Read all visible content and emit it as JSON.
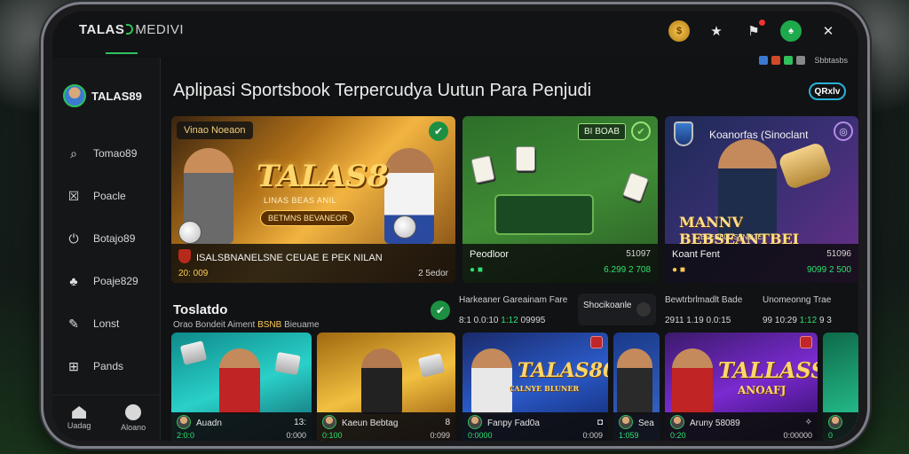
{
  "app": {
    "brand": "TALAS",
    "brand_thin": "MEDIVI"
  },
  "header": {
    "icons": [
      "coin-icon",
      "star-icon",
      "notification-icon",
      "account-icon",
      "close-icon"
    ],
    "mini_label": "Sbbtasbs"
  },
  "sidebar": {
    "profile_name": "TALAS89",
    "items": [
      {
        "label": "Tomao89",
        "icon": "search-icon"
      },
      {
        "label": "Poacle",
        "icon": "cross-box-icon"
      },
      {
        "label": "Botajo89",
        "icon": "power-icon"
      },
      {
        "label": "Poaje829",
        "icon": "cards-icon"
      },
      {
        "label": "Lonst",
        "icon": "edit-icon"
      },
      {
        "label": "Pands",
        "icon": "gift-icon"
      }
    ],
    "bottom": [
      {
        "label": "Uadag",
        "icon": "home-icon"
      },
      {
        "label": "Aloano",
        "icon": "profile-icon"
      }
    ]
  },
  "main": {
    "headline": "Aplipasi Sportsbook Terpercudya Uutun Para Penjudi",
    "qr_label": "QRxlv",
    "heroes": [
      {
        "tag": "Vinao Noeaon",
        "logo": "TALAS8",
        "sub": "LINAS BEAS ANIL",
        "pill": "BETMNS BEVANEOR",
        "title": "ISALSBNANELSNE CEUAE E PEK NILAN",
        "left": "20: 009",
        "right": "2 5edor"
      },
      {
        "tag": "BI BOAB",
        "title": "Peodloor",
        "right_top": "51097",
        "bottom": "6.299 2 708"
      },
      {
        "title": "Koanorfas (Sinoclant",
        "logo": "MANNV BEBSEANTBEI",
        "logo_sub": "BEEBBLOSTNOTEI",
        "footer_title": "Koant Fent",
        "right_top": "51096",
        "bottom": "9099 2 500"
      }
    ],
    "section": {
      "title": "Toslatdo",
      "sub_prefix": "Orao Bondeit Aiment",
      "sub_accent": "BSNB",
      "sub_suffix": "Bieuame"
    },
    "scores": [
      {
        "line1": "Harkeaner Gareainam Fare",
        "line2_left": "8:1 0.0:10",
        "line2_green": "1:12",
        "line2_right": "09995"
      },
      {
        "chip": "Shocikoanle"
      },
      {
        "line1": "Bewtrbrlmadlt Bade",
        "line2_left": "2911 1.19",
        "line2_green": "",
        "line2_right": "0.0:15"
      },
      {
        "line1": "Unomeonng Trae",
        "line2_left": "99 10:29",
        "line2_green": "1:12",
        "line2_right": "9 3"
      }
    ],
    "games": [
      {
        "name": "Auadn",
        "count": "13:",
        "left": "2:0:0",
        "right": "0:000"
      },
      {
        "name": "Kaeun Bebtag",
        "count": "8",
        "left": "0:100",
        "right": "0:099"
      },
      {
        "name": "Fanpy Fad0a",
        "count": "",
        "left": "0:0000",
        "right": "0:009"
      },
      {
        "name": "Sea",
        "count": "",
        "left": "1:059",
        "right": ""
      },
      {
        "name": "Aruny 58089",
        "count": "",
        "left": "0:20",
        "right": "0:00000"
      },
      {
        "name": "",
        "count": "",
        "left": "0",
        "right": ""
      }
    ],
    "game_logos": [
      "TALAS80",
      "TALLASS",
      "ANOAFJ",
      "CALNYE BLUNER"
    ]
  },
  "colors": {
    "accent": "#2ec05a",
    "gold": "#ffcc55",
    "bg": "#111214"
  }
}
